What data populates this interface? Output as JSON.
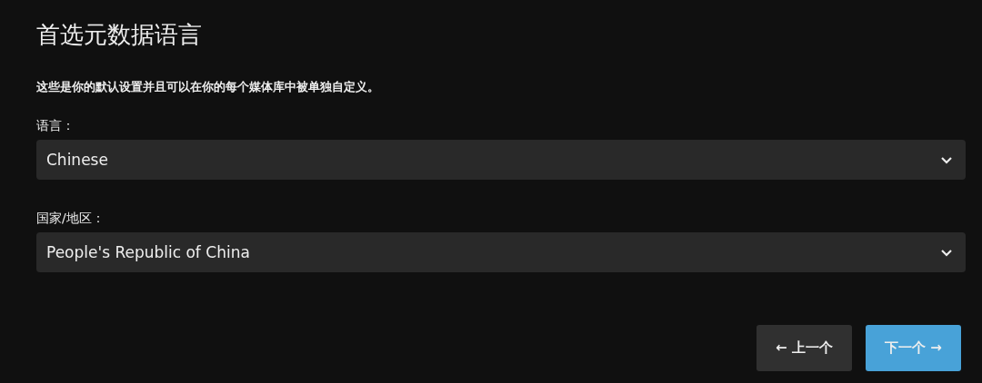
{
  "title": "首选元数据语言",
  "description": "这些是你的默认设置并且可以在你的每个媒体库中被单独自定义。",
  "fields": [
    {
      "label": "语言：",
      "value": "Chinese"
    },
    {
      "label": "国家/地区：",
      "value": "People's Republic of China"
    }
  ],
  "buttons": [
    {
      "label": "← 上一个",
      "kind": "secondary"
    },
    {
      "label": "下一个 →",
      "kind": "primary"
    }
  ]
}
